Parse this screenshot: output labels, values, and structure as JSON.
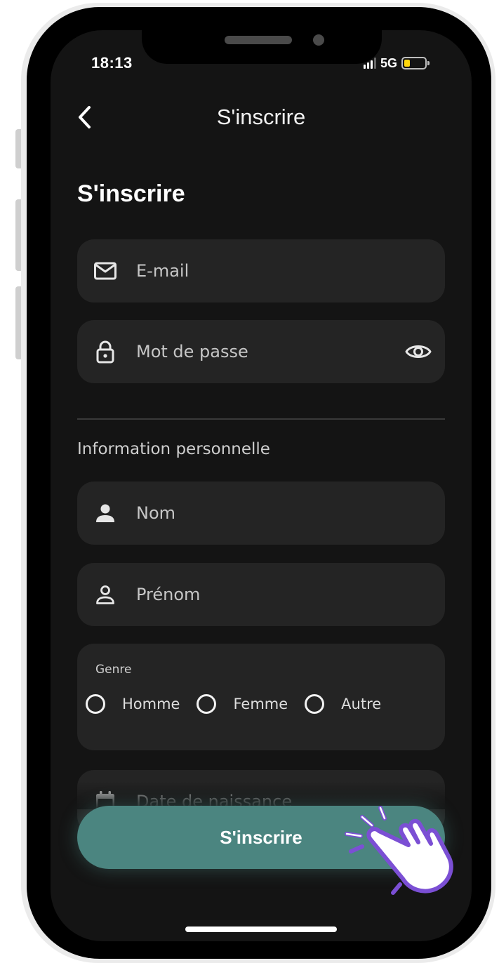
{
  "status_bar": {
    "time": "18:13",
    "network": "5G"
  },
  "nav": {
    "title": "S'inscrire"
  },
  "form": {
    "title": "S'inscrire",
    "email_placeholder": "E-mail",
    "password_placeholder": "Mot de passe",
    "personal_section_label": "Information personnelle",
    "last_name_placeholder": "Nom",
    "first_name_placeholder": "Prénom",
    "gender": {
      "label": "Genre",
      "options": [
        {
          "label": "Homme"
        },
        {
          "label": "Femme"
        },
        {
          "label": "Autre"
        }
      ]
    },
    "birthdate_placeholder": "Date de naissance",
    "submit_label": "S'inscrire"
  },
  "icons": {
    "back": "chevron-left-icon",
    "email": "mail-icon",
    "password": "lock-icon",
    "toggle_password": "eye-icon",
    "last_name": "person-filled-icon",
    "first_name": "person-outline-icon",
    "birthdate": "calendar-icon",
    "pointer": "hand-tap-icon"
  },
  "colors": {
    "background": "#141414",
    "field": "#242424",
    "accent": "#4b8580",
    "battery": "#ffd60a",
    "tap_highlight": "#7b4fd4"
  }
}
